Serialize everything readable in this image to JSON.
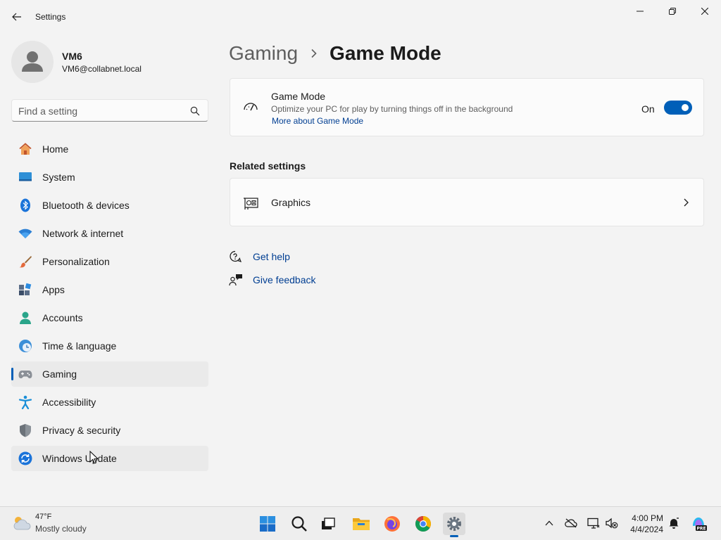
{
  "window": {
    "title": "Settings"
  },
  "user": {
    "name": "VM6",
    "email": "VM6@collabnet.local"
  },
  "search": {
    "placeholder": "Find a setting"
  },
  "nav": {
    "items": [
      {
        "label": "Home",
        "icon": "home-icon"
      },
      {
        "label": "System",
        "icon": "system-icon"
      },
      {
        "label": "Bluetooth & devices",
        "icon": "bluetooth-icon"
      },
      {
        "label": "Network & internet",
        "icon": "wifi-icon"
      },
      {
        "label": "Personalization",
        "icon": "brush-icon"
      },
      {
        "label": "Apps",
        "icon": "apps-icon"
      },
      {
        "label": "Accounts",
        "icon": "accounts-icon"
      },
      {
        "label": "Time & language",
        "icon": "clock-globe-icon"
      },
      {
        "label": "Gaming",
        "icon": "gamepad-icon",
        "selected": true
      },
      {
        "label": "Accessibility",
        "icon": "accessibility-icon"
      },
      {
        "label": "Privacy & security",
        "icon": "shield-icon"
      },
      {
        "label": "Windows Update",
        "icon": "update-icon"
      }
    ]
  },
  "breadcrumb": {
    "parent": "Gaming",
    "current": "Game Mode"
  },
  "game_mode": {
    "title": "Game Mode",
    "description": "Optimize your PC for play by turning things off in the background",
    "link": "More about Game Mode",
    "toggle_label": "On",
    "toggle_on": true
  },
  "related": {
    "title": "Related settings",
    "graphics_label": "Graphics"
  },
  "help": {
    "get_help": "Get help",
    "give_feedback": "Give feedback"
  },
  "taskbar": {
    "weather_temp": "47°F",
    "weather_condition": "Mostly cloudy",
    "time": "4:00 PM",
    "date": "4/4/2024",
    "pinned": [
      "start-icon",
      "search-icon",
      "task-view-icon",
      "file-explorer-icon",
      "firefox-icon",
      "chrome-icon",
      "settings-icon"
    ]
  },
  "colors": {
    "accent": "#005fb8",
    "link": "#003e92",
    "background": "#f3f3f3",
    "card": "#fbfbfb"
  }
}
